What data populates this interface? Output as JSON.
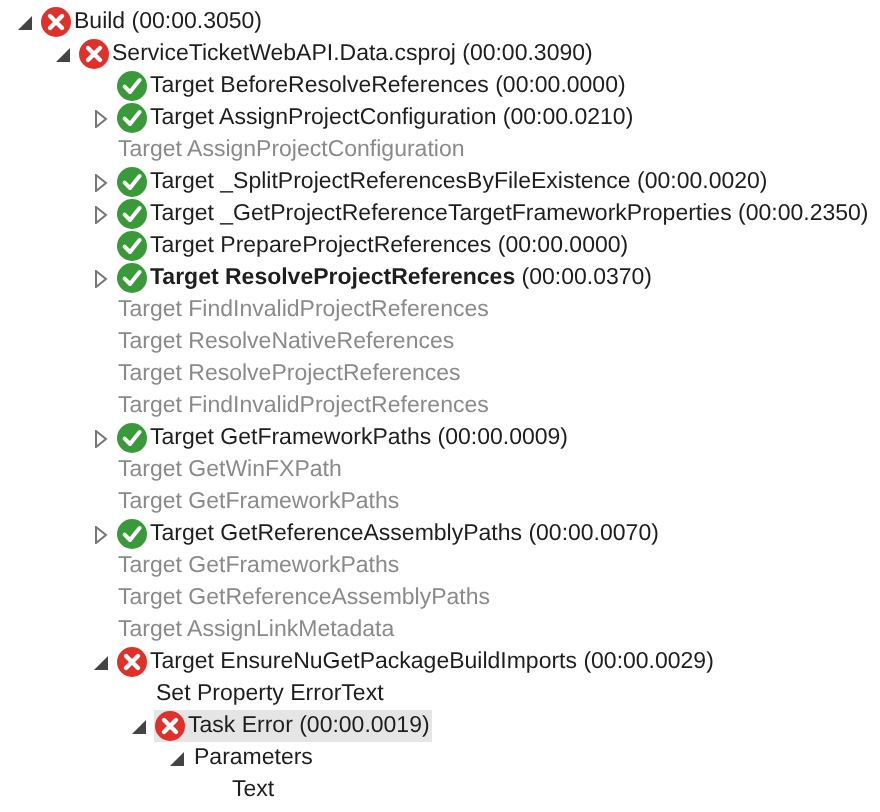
{
  "tree": [
    {
      "label": "Build (00:00.3050)",
      "kind": "error",
      "expanded": true,
      "greyed": false,
      "selected": false,
      "children": [
        {
          "label": "ServiceTicketWebAPI.Data.csproj (00:00.3090)",
          "kind": "error",
          "expanded": true,
          "greyed": false,
          "selected": false,
          "children": [
            {
              "label": "Target BeforeResolveReferences (00:00.0000)",
              "kind": "success",
              "greyed": false,
              "selected": false
            },
            {
              "label": "Target AssignProjectConfiguration (00:00.0210)",
              "kind": "success",
              "expanded": false,
              "greyed": false,
              "selected": false
            },
            {
              "label": "Target AssignProjectConfiguration",
              "greyed": true,
              "selected": false
            },
            {
              "label": "Target _SplitProjectReferencesByFileExistence (00:00.0020)",
              "kind": "success",
              "expanded": false,
              "greyed": false,
              "selected": false
            },
            {
              "label": "Target _GetProjectReferenceTargetFrameworkProperties (00:00.2350)",
              "kind": "success",
              "expanded": false,
              "greyed": false,
              "selected": false
            },
            {
              "label": "Target PrepareProjectReferences (00:00.0000)",
              "kind": "success",
              "greyed": false,
              "selected": false
            },
            {
              "label": "**Target ResolveProjectReferences** (00:00.0370)",
              "kind": "success",
              "expanded": false,
              "greyed": false,
              "selected": false
            },
            {
              "label": "Target FindInvalidProjectReferences",
              "greyed": true,
              "selected": false
            },
            {
              "label": "Target ResolveNativeReferences",
              "greyed": true,
              "selected": false
            },
            {
              "label": "Target ResolveProjectReferences",
              "greyed": true,
              "selected": false
            },
            {
              "label": "Target FindInvalidProjectReferences",
              "greyed": true,
              "selected": false
            },
            {
              "label": "Target GetFrameworkPaths (00:00.0009)",
              "kind": "success",
              "expanded": false,
              "greyed": false,
              "selected": false
            },
            {
              "label": "Target GetWinFXPath",
              "greyed": true,
              "selected": false
            },
            {
              "label": "Target GetFrameworkPaths",
              "greyed": true,
              "selected": false
            },
            {
              "label": "Target GetReferenceAssemblyPaths (00:00.0070)",
              "kind": "success",
              "expanded": false,
              "greyed": false,
              "selected": false
            },
            {
              "label": "Target GetFrameworkPaths",
              "greyed": true,
              "selected": false
            },
            {
              "label": "Target GetReferenceAssemblyPaths",
              "greyed": true,
              "selected": false
            },
            {
              "label": "Target AssignLinkMetadata",
              "greyed": true,
              "selected": false
            },
            {
              "label": "Target EnsureNuGetPackageBuildImports (00:00.0029)",
              "kind": "error",
              "expanded": true,
              "greyed": false,
              "selected": false,
              "children": [
                {
                  "label": "Set Property ErrorText",
                  "greyed": false,
                  "selected": false
                },
                {
                  "label": "Task Error (00:00.0019)",
                  "kind": "error",
                  "expanded": true,
                  "greyed": false,
                  "selected": true,
                  "children": [
                    {
                      "label": "Parameters",
                      "expanded": true,
                      "greyed": false,
                      "selected": false,
                      "children": [
                        {
                          "label": "Text",
                          "greyed": false,
                          "selected": false
                        }
                      ]
                    }
                  ]
                }
              ]
            }
          ]
        }
      ]
    }
  ]
}
